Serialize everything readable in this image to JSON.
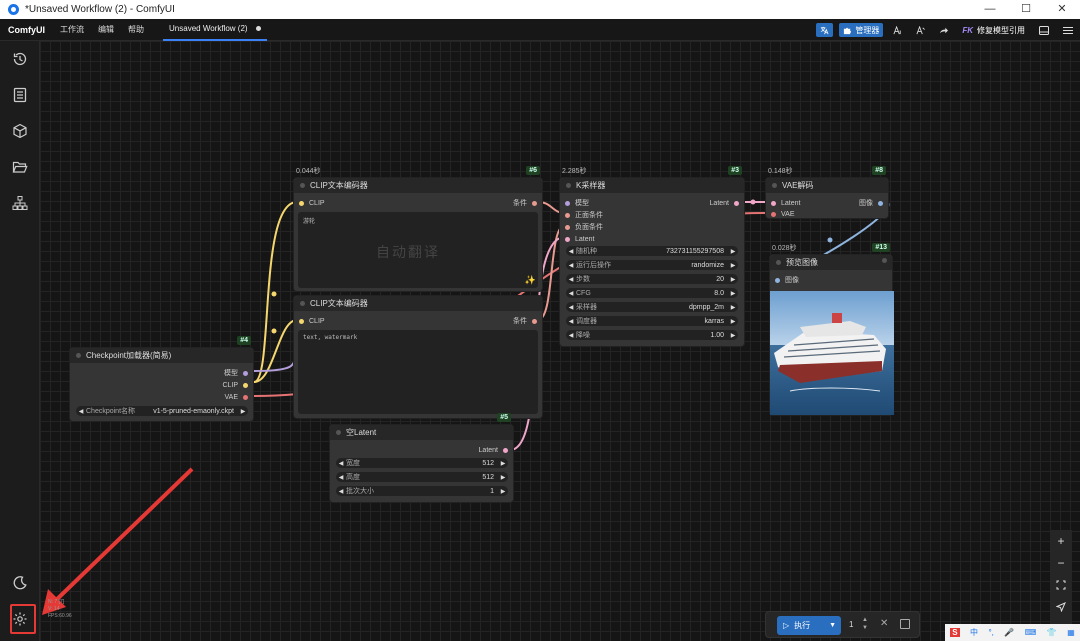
{
  "window": {
    "title": "*Unsaved Workflow (2) - ComfyUI",
    "min": "—",
    "max": "☐",
    "close": "✕"
  },
  "menubar": {
    "brand": "ComfyUI",
    "items": [
      "工作流",
      "编辑",
      "帮助"
    ],
    "tab_label": "Unsaved Workflow (2)",
    "manager_label": "管理器",
    "fix_prefix": "FK",
    "fix_label": "修复模型引用"
  },
  "nodes": {
    "clip1": {
      "timing": "0.044秒",
      "badge": "#6",
      "title": "CLIP文本编码器",
      "in": "CLIP",
      "out": "条件",
      "text": "游轮",
      "watermark": "自动翻译"
    },
    "clip2": {
      "title": "CLIP文本编码器",
      "in": "CLIP",
      "out": "条件",
      "text": "text, watermark"
    },
    "ksampler": {
      "timing": "2.285秒",
      "badge": "#3",
      "title": "K采样器",
      "inputs": [
        "模型",
        "正面条件",
        "负面条件",
        "Latent"
      ],
      "out": "Latent",
      "widgets": [
        {
          "label": "随机种",
          "value": "732731155297508"
        },
        {
          "label": "运行后操作",
          "value": "randomize"
        },
        {
          "label": "步数",
          "value": "20"
        },
        {
          "label": "CFG",
          "value": "8.0"
        },
        {
          "label": "采样器",
          "value": "dpmpp_2m"
        },
        {
          "label": "调度器",
          "value": "karras"
        },
        {
          "label": "降噪",
          "value": "1.00"
        }
      ]
    },
    "vae": {
      "timing": "0.148秒",
      "badge": "#8",
      "title": "VAE解码",
      "inputs": [
        "Latent",
        "VAE"
      ],
      "out": "图像"
    },
    "preview": {
      "timing": "0.028秒",
      "badge": "#13",
      "title": "预览图像",
      "in": "图像"
    },
    "checkpoint": {
      "badge": "#4",
      "title": "Checkpoint加载器(简易)",
      "outs": [
        "模型",
        "CLIP",
        "VAE"
      ],
      "widget_label": "Checkpoint名称",
      "widget_value": "v1-5-pruned-emaonly.ckpt"
    },
    "latent": {
      "badge": "#5",
      "title": "空Latent",
      "out": "Latent",
      "widgets": [
        {
          "label": "宽度",
          "value": "512"
        },
        {
          "label": "高度",
          "value": "512"
        },
        {
          "label": "批次大小",
          "value": "1"
        }
      ]
    }
  },
  "runbar": {
    "run_label": "执行",
    "count": "1"
  },
  "stats": {
    "line1": "N: 7 [7]",
    "line2": "V: 14",
    "line3": "FPS:60.96"
  },
  "taskbar": {
    "ime": "中"
  },
  "colors": {
    "accent": "#2a6fbf",
    "clip_wire": "#f5d76e",
    "cond_wire": "#e89a90",
    "vae_wire": "#e57373",
    "model_wire": "#b39ddb",
    "latent_wire": "#f0a6c8",
    "image_wire": "#8fb4e0",
    "annotation": "#e53935"
  }
}
